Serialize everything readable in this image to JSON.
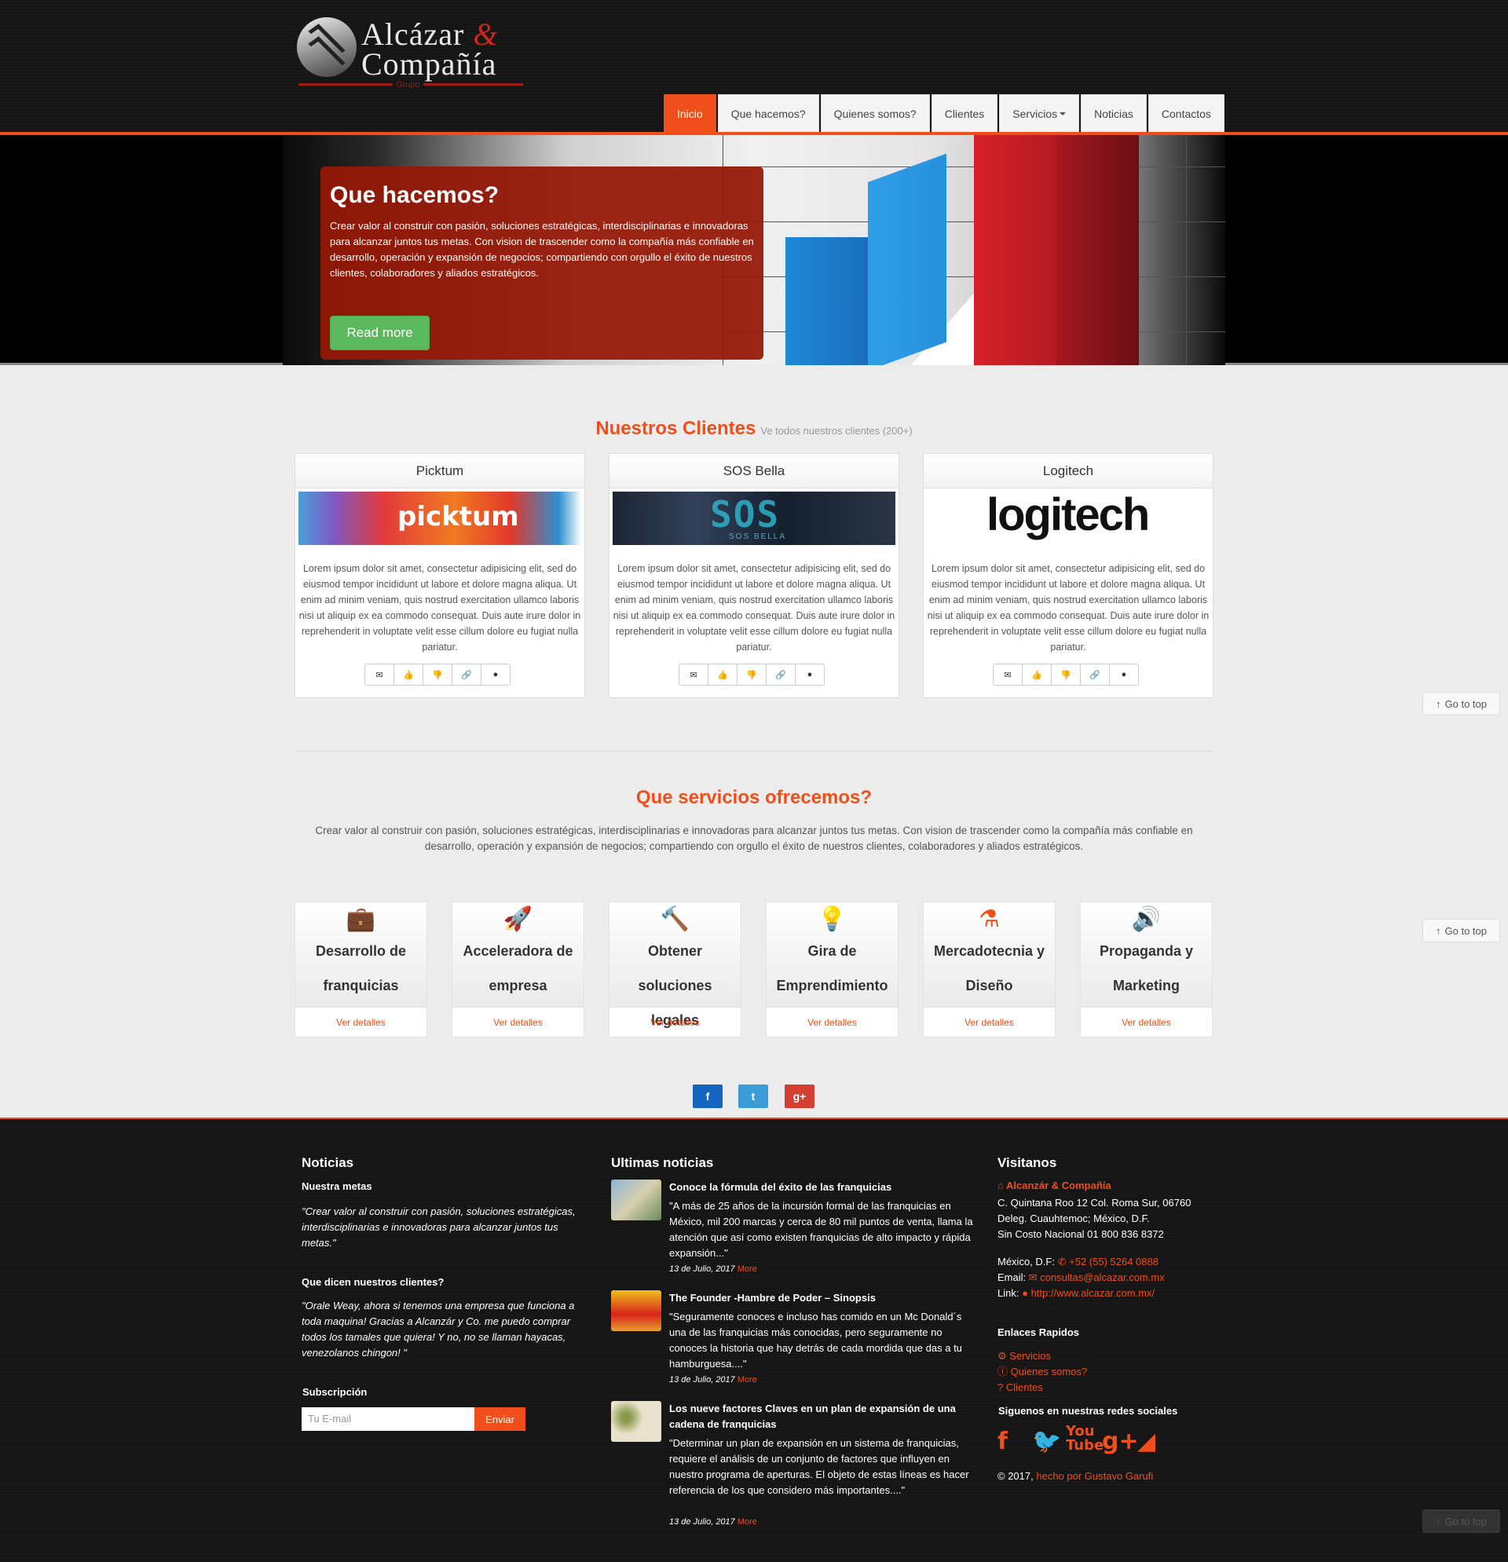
{
  "logo": {
    "line1": "Alcázar",
    "amp": "&",
    "line2": "Compañía",
    "grupo": "Grupo"
  },
  "nav": {
    "items": [
      "Inicio",
      "Que hacemos?",
      "Quienes somos?",
      "Clientes",
      "Servicios",
      "Noticias",
      "Contactos"
    ],
    "active": "Inicio"
  },
  "hero": {
    "title": "Que hacemos?",
    "text": "Crear valor al construir con pasión, soluciones estratégicas, interdisciplinarias e innovadoras para alcanzar juntos tus metas. Con vision de trascender como la compañía más confiable en desarrollo, operación y expansión de negocios; compartiendo con orgullo el éxito de nuestros clientes, colaboradores y aliados estratégicos.",
    "button": "Read more"
  },
  "clients": {
    "title": "Nuestros Clientes",
    "subtitle": "Ve todos nuestros clientes (200+)",
    "cards": [
      {
        "name": "Picktum",
        "logo_text": "picktum",
        "text": "Lorem ipsum dolor sit amet, consectetur adipisicing elit, sed do eiusmod tempor incididunt ut labore et dolore magna aliqua. Ut enim ad minim veniam, quis nostrud exercitation ullamco laboris nisi ut aliquip ex ea commodo consequat. Duis aute irure dolor in reprehenderit in voluptate velit esse cillum dolore eu fugiat nulla pariatur."
      },
      {
        "name": "SOS Bella",
        "logo_text": "SOS",
        "logo_sub": "SOS BELLA",
        "text": "Lorem ipsum dolor sit amet, consectetur adipisicing elit, sed do eiusmod tempor incididunt ut labore et dolore magna aliqua. Ut enim ad minim veniam, quis nostrud exercitation ullamco laboris nisi ut aliquip ex ea commodo consequat. Duis aute irure dolor in reprehenderit in voluptate velit esse cillum dolore eu fugiat nulla pariatur."
      },
      {
        "name": "Logitech",
        "logo_text": "logitech",
        "text": "Lorem ipsum dolor sit amet, consectetur adipisicing elit, sed do eiusmod tempor incididunt ut labore et dolore magna aliqua. Ut enim ad minim veniam, quis nostrud exercitation ullamco laboris nisi ut aliquip ex ea commodo consequat. Duis aute irure dolor in reprehenderit in voluptate velit esse cillum dolore eu fugiat nulla pariatur."
      }
    ],
    "card_buttons": [
      "envelope-icon",
      "thumbs-up-icon",
      "thumbs-down-icon",
      "link-icon",
      "globe-icon"
    ]
  },
  "go_top": "Go to top",
  "services": {
    "title": "Que servicios ofrecemos?",
    "intro": "Crear valor al construir con pasión, soluciones estratégicas, interdisciplinarias e innovadoras para alcanzar juntos tus metas. Con vision de trascender como la compañía más confiable en desarrollo, operación y expansión de negocios; compartiendo con orgullo el éxito de nuestros clientes, colaboradores y aliados estratégicos.",
    "items": [
      {
        "icon": "briefcase-icon",
        "line1": "Desarrollo de",
        "line2": "franquicias",
        "link": "Ver detalles"
      },
      {
        "icon": "rocket-icon",
        "line1": "Acceleradora de",
        "line2": "empresa",
        "link": "Ver detalles"
      },
      {
        "icon": "gavel-icon",
        "line1": "Obtener soluciones",
        "line2": "legales",
        "link": "Ver detalles"
      },
      {
        "icon": "lightbulb-icon",
        "line1": "Gira de",
        "line2": "Emprendimiento",
        "link": "Ver detalles"
      },
      {
        "icon": "flask-icon",
        "line1": "Mercadotecnia y",
        "line2": "Diseño",
        "link": "Ver detalles"
      },
      {
        "icon": "megaphone-icon",
        "line1": "Propaganda y",
        "line2": "Marketing",
        "link": "Ver detalles"
      }
    ]
  },
  "share": {
    "facebook": "f",
    "twitter": "t",
    "google": "g+"
  },
  "footer": {
    "noticias": {
      "title": "Noticias",
      "metas_title": "Nuestra metas",
      "metas_text": "\"Crear valor al construir con pasión, soluciones estratégicas, interdisciplinarias e innovadoras para alcanzar juntos tus metas.\"",
      "dicen_title": "Que dicen nuestros clientes?",
      "dicen_text": "\"Orale Weay, ahora si tenemos una empresa que funciona a toda maquina! Gracias a Alcanzár y Co. me puedo comprar todos los tamales que quiera! Y no, no se llaman hayacas, venezolanos chingon! \"",
      "sub_title": "Subscripción",
      "sub_placeholder": "Tu E-mail",
      "sub_button": "Enviar"
    },
    "ultimas": {
      "title": "Ultimas noticias",
      "items": [
        {
          "title": "Conoce la fórmula del éxito de las franquicias",
          "body": "\"A más de 25 años de la incursión formal de las franquicias en México, mil 200 marcas y cerca de 80 mil puntos de venta, llama la atención que así como existen franquicias de alto impacto y rápida expansión...\"",
          "date": "13 de Julio, 2017",
          "more": "More"
        },
        {
          "title": "The Founder -Hambre de Poder – Sinopsis",
          "body": "\"Seguramente conoces e incluso has comido en un Mc Donald´s una de las franquicias más conocidas, pero seguramente no conoces la historia que hay detrás de cada mordida que das a tu hamburguesa....\"",
          "date": "13 de Julio, 2017",
          "more": "More"
        },
        {
          "title": "Los nueve factores Claves en un plan de expansión de una cadena de franquicias",
          "body": "\"Determinar un plan de expansión en un sistema de franquicias, requiere el análisis de un conjunto de factores que influyen en nuestro programa de aperturas. El objeto de estas líneas es hacer referencia de los que considero más importantes....\"",
          "date": "13 de Julio, 2017",
          "more": "More"
        }
      ]
    },
    "visitanos": {
      "title": "Visitanos",
      "company": "Alcanzár & Compañía",
      "address1": "C. Quintana Roo 12 Col. Roma Sur, 06760",
      "address2": "Deleg. Cuauhtemoc; México, D.F.",
      "address3": "Sin Costo Nacional 01 800 836 8372",
      "phone_label": "México, D.F:",
      "phone": "+52 (55) 5264 0888",
      "email_label": "Email:",
      "email": "consultas@alcazar.com.mx",
      "link_label": "Link:",
      "link": "http://www.alcazar.com.mx/",
      "rapidos_title": "Enlaces Rapidos",
      "rapidos": [
        "Servicios",
        "Quienes somos?",
        "Clientes"
      ],
      "redes_title": "Siguenos en nuestras redes sociales",
      "copyright": "© 2017,",
      "credit": "hecho por Gustavo Garufi"
    }
  },
  "colors": {
    "accent": "#f04e1a",
    "hero_box": "#961806",
    "success": "#5cb85c"
  }
}
